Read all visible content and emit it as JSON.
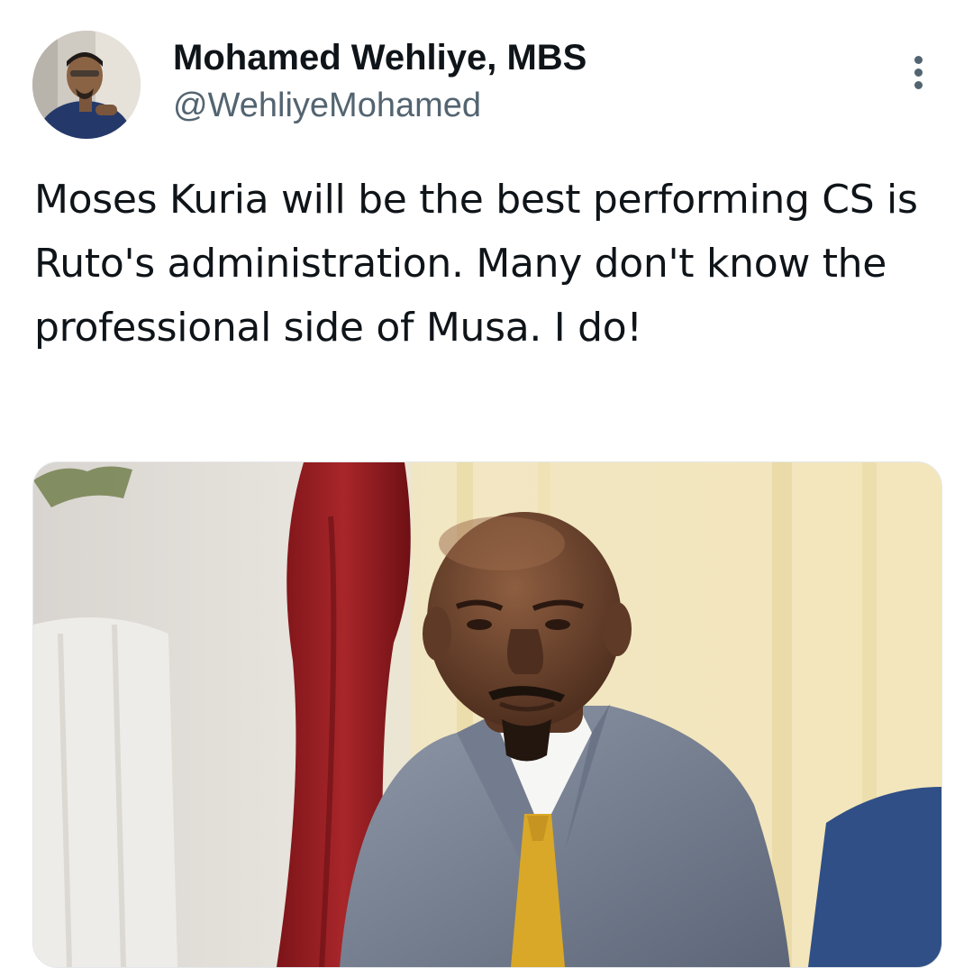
{
  "author": {
    "display_name": "Mohamed Wehliye, MBS",
    "handle": "@WehliyeMohamed",
    "avatar_icon": "profile-photo"
  },
  "menu": {
    "icon": "more-vertical-icon"
  },
  "tweet": {
    "text": "Moses Kuria will be the best performing CS is Ruto's administration. Many don't know the professional side of Musa. I do!"
  },
  "media": {
    "kind": "photo"
  },
  "colors": {
    "text": "#0f1419",
    "secondary": "#536471",
    "background": "#ffffff"
  }
}
